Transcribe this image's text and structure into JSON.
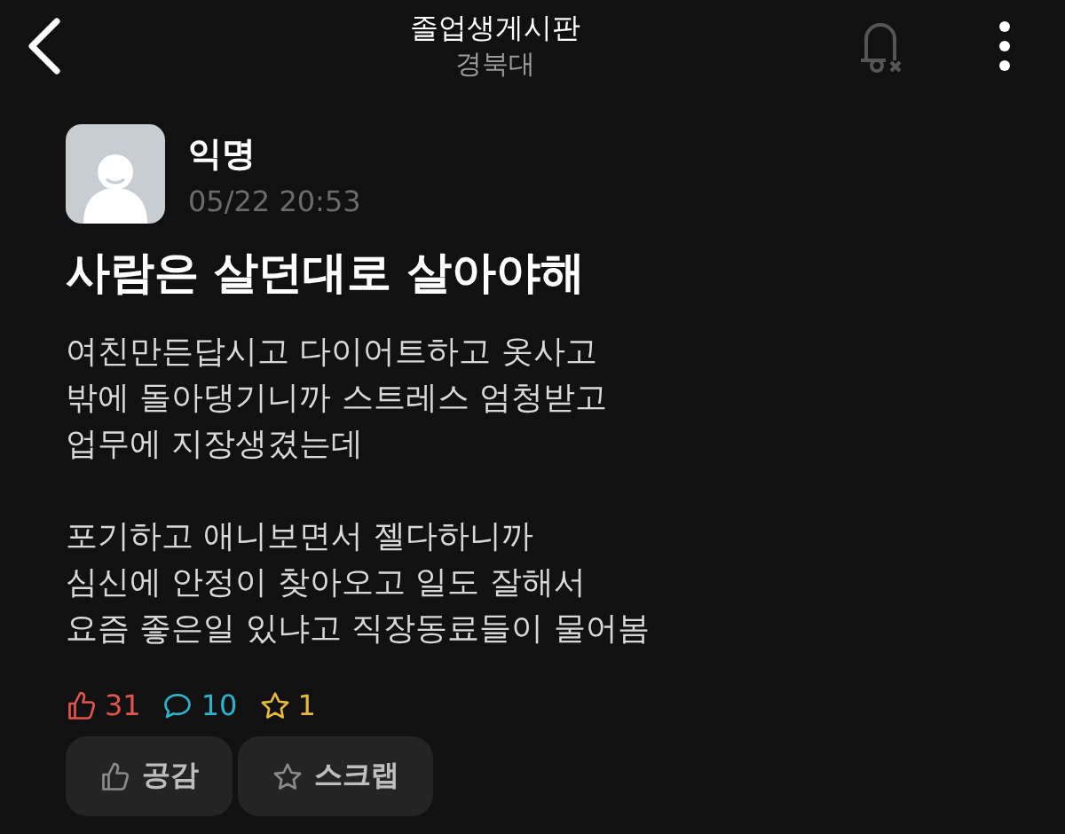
{
  "header": {
    "title": "졸업생게시판",
    "subtitle": "경북대"
  },
  "post": {
    "author": "익명",
    "time": "05/22 20:53",
    "title": "사람은 살던대로 살아야해",
    "paragraphs": [
      "여친만든답시고 다이어트하고 옷사고\n밖에 돌아댕기니까 스트레스 엄청받고\n업무에 지장생겼는데",
      "포기하고 애니보면서 젤다하니까\n심신에 안정이 찾아오고 일도 잘해서\n요즘 좋은일 있냐고 직장동료들이 물어봄"
    ],
    "stats": [
      {
        "kind": "like",
        "count": "31",
        "color": "#e0564e"
      },
      {
        "kind": "comment",
        "count": "10",
        "color": "#2bb3c9"
      },
      {
        "kind": "scrap",
        "count": "1",
        "color": "#e8b93a"
      }
    ],
    "buttons": [
      {
        "kind": "like",
        "label": "공감"
      },
      {
        "kind": "scrap",
        "label": "스크랩"
      }
    ]
  }
}
